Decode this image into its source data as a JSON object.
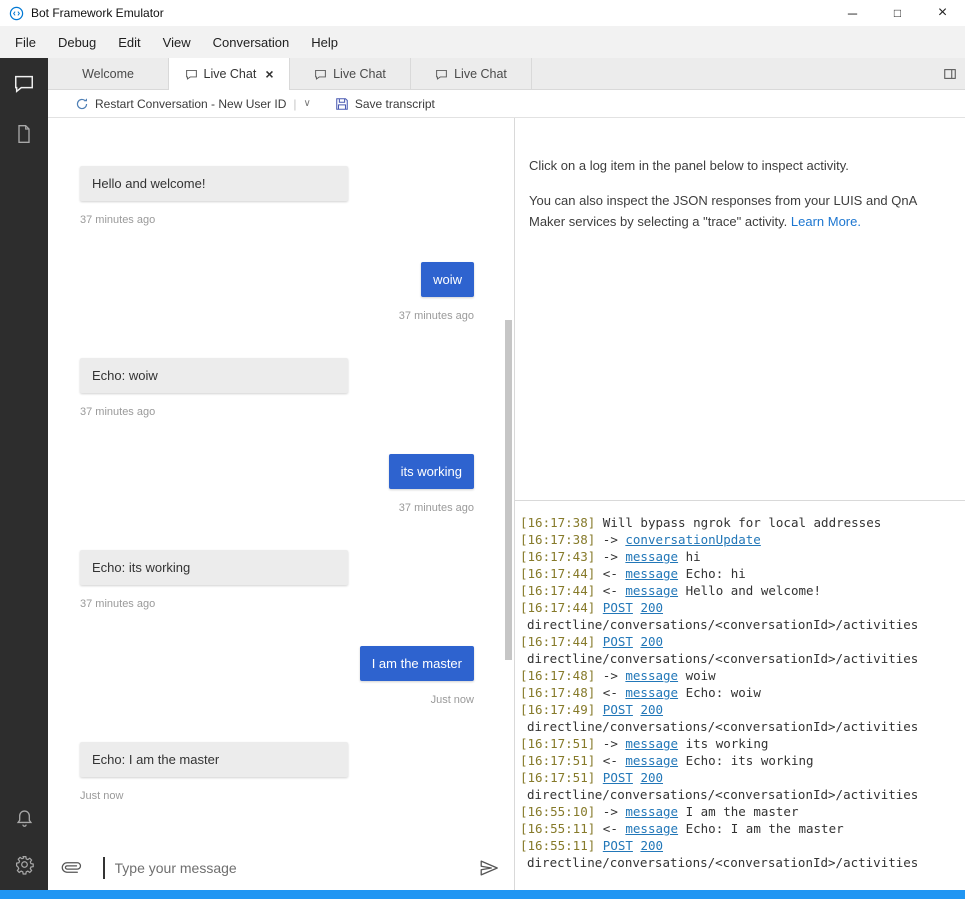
{
  "titlebar": {
    "title": "Bot Framework Emulator",
    "minimize_glyph": "─",
    "maximize_glyph": "□",
    "close_glyph": "×"
  },
  "menu": {
    "items": [
      "File",
      "Debug",
      "Edit",
      "View",
      "Conversation",
      "Help"
    ]
  },
  "tabs": {
    "close_glyph": "×",
    "items": [
      {
        "label": "Welcome",
        "active": false,
        "icon": false,
        "closable": false
      },
      {
        "label": "Live Chat",
        "active": true,
        "icon": true,
        "closable": true
      },
      {
        "label": "Live Chat",
        "active": false,
        "icon": true,
        "closable": false
      },
      {
        "label": "Live Chat",
        "active": false,
        "icon": true,
        "closable": false
      }
    ]
  },
  "toolbar": {
    "restart_label": "Restart Conversation - New User ID",
    "separator": "|",
    "chevron": "∨",
    "save_label": "Save transcript"
  },
  "chat": {
    "input_placeholder": "Type your message",
    "messages": [
      {
        "side": "bot",
        "text": "Hello and welcome!",
        "time": "37 minutes ago"
      },
      {
        "side": "user",
        "text": "woiw",
        "time": "37 minutes ago"
      },
      {
        "side": "bot",
        "text": "Echo: woiw",
        "time": "37 minutes ago"
      },
      {
        "side": "user",
        "text": "its working",
        "time": "37 minutes ago"
      },
      {
        "side": "bot",
        "text": "Echo: its working",
        "time": "37 minutes ago"
      },
      {
        "side": "user",
        "text": "I am the master",
        "time": "Just now"
      },
      {
        "side": "bot",
        "text": "Echo: I am the master",
        "time": "Just now"
      }
    ]
  },
  "inspector": {
    "paragraph1": "Click on a log item in the panel below to inspect activity.",
    "paragraph2": "You can also inspect the JSON responses from your LUIS and QnA Maker services by selecting a \"trace\" activity.",
    "learn_more_label": "Learn More."
  },
  "log": {
    "entries": [
      {
        "time": "[16:17:38]",
        "parts": [
          {
            "text": "Will bypass ngrok for local addresses"
          }
        ]
      },
      {
        "time": "[16:17:38]",
        "parts": [
          {
            "text": "-> "
          },
          {
            "text": "conversationUpdate",
            "link": true
          }
        ]
      },
      {
        "time": "[16:17:43]",
        "parts": [
          {
            "text": "-> "
          },
          {
            "text": "message",
            "link": true
          },
          {
            "text": " hi"
          }
        ]
      },
      {
        "time": "[16:17:44]",
        "parts": [
          {
            "text": "<- "
          },
          {
            "text": "message",
            "link": true
          },
          {
            "text": " Echo: hi"
          }
        ]
      },
      {
        "time": "[16:17:44]",
        "parts": [
          {
            "text": "<- "
          },
          {
            "text": "message",
            "link": true
          },
          {
            "text": " Hello and welcome!"
          }
        ]
      },
      {
        "time": "[16:17:44]",
        "parts": [
          {
            "text": "POST",
            "link": true
          },
          {
            "text": " "
          },
          {
            "text": "200",
            "link": true
          }
        ],
        "cont": "directline/conversations/<conversationId>/activities"
      },
      {
        "time": "[16:17:44]",
        "parts": [
          {
            "text": "POST",
            "link": true
          },
          {
            "text": " "
          },
          {
            "text": "200",
            "link": true
          }
        ],
        "cont": "directline/conversations/<conversationId>/activities"
      },
      {
        "time": "[16:17:48]",
        "parts": [
          {
            "text": "-> "
          },
          {
            "text": "message",
            "link": true
          },
          {
            "text": " woiw"
          }
        ]
      },
      {
        "time": "[16:17:48]",
        "parts": [
          {
            "text": "<- "
          },
          {
            "text": "message",
            "link": true
          },
          {
            "text": " Echo: woiw"
          }
        ]
      },
      {
        "time": "[16:17:49]",
        "parts": [
          {
            "text": "POST",
            "link": true
          },
          {
            "text": " "
          },
          {
            "text": "200",
            "link": true
          }
        ],
        "cont": "directline/conversations/<conversationId>/activities"
      },
      {
        "time": "[16:17:51]",
        "parts": [
          {
            "text": "-> "
          },
          {
            "text": "message",
            "link": true
          },
          {
            "text": " its working"
          }
        ]
      },
      {
        "time": "[16:17:51]",
        "parts": [
          {
            "text": "<- "
          },
          {
            "text": "message",
            "link": true
          },
          {
            "text": " Echo: its working"
          }
        ]
      },
      {
        "time": "[16:17:51]",
        "parts": [
          {
            "text": "POST",
            "link": true
          },
          {
            "text": " "
          },
          {
            "text": "200",
            "link": true
          }
        ],
        "cont": "directline/conversations/<conversationId>/activities"
      },
      {
        "time": "[16:55:10]",
        "parts": [
          {
            "text": "-> "
          },
          {
            "text": "message",
            "link": true
          },
          {
            "text": " I am the master"
          }
        ]
      },
      {
        "time": "[16:55:11]",
        "parts": [
          {
            "text": "<- "
          },
          {
            "text": "message",
            "link": true
          },
          {
            "text": " Echo: I am the master"
          }
        ]
      },
      {
        "time": "[16:55:11]",
        "parts": [
          {
            "text": "POST",
            "link": true
          },
          {
            "text": " "
          },
          {
            "text": "200",
            "link": true
          }
        ],
        "cont": "directline/conversations/<conversationId>/activities"
      }
    ]
  },
  "colors": {
    "user_bubble": "#2e63cf",
    "status_bar": "#2196f3",
    "log_link": "#2277b8",
    "log_timestamp": "#867a2a",
    "inspector_link": "#1c76d0"
  }
}
